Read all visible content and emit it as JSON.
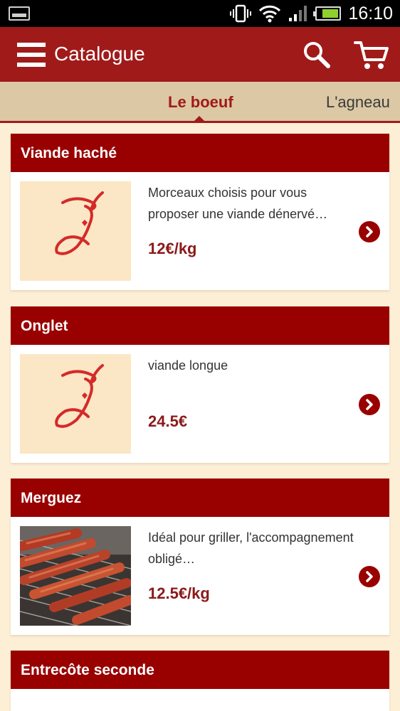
{
  "status_bar": {
    "time": "16:10",
    "battery_level": 0.8
  },
  "app_bar": {
    "title": "Catalogue",
    "menu_icon": "hamburger-menu-icon",
    "search_icon": "search-icon",
    "cart_icon": "shopping-cart-icon"
  },
  "tabs": [
    {
      "label": "Le boeuf",
      "active": true
    },
    {
      "label": "L'agneau",
      "active": false
    }
  ],
  "products": [
    {
      "title": "Viande haché",
      "description": "Morceaux choisis pour vous proposer une viande dénervé…",
      "price": "12€/kg",
      "image": "logo-placeholder"
    },
    {
      "title": "Onglet",
      "description": "viande longue",
      "price": "24.5€",
      "image": "logo-placeholder"
    },
    {
      "title": "Merguez",
      "description": "Idéal pour griller, l'accompagnement obligé…",
      "price": "12.5€/kg",
      "image": "grilled-sausages-photo"
    },
    {
      "title": "Entrecôte seconde",
      "description": "",
      "price": "",
      "image": ""
    }
  ],
  "colors": {
    "app_bar": "#a01a1a",
    "card_header": "#990000",
    "tab_bar": "#dcc8a4",
    "background": "#fdefd6",
    "price": "#8b1a1a"
  }
}
